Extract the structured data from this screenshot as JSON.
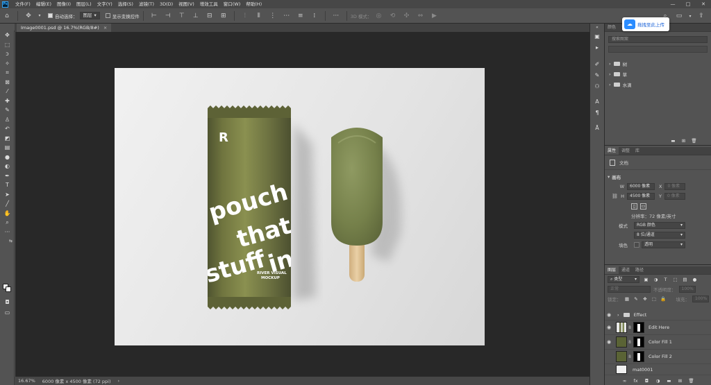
{
  "app": {
    "logo": "Ps"
  },
  "menu": [
    "文件(F)",
    "编辑(E)",
    "图像(I)",
    "图层(L)",
    "文字(Y)",
    "选择(S)",
    "滤镜(T)",
    "3D(D)",
    "视图(V)",
    "增效工具",
    "窗口(W)",
    "帮助(H)"
  ],
  "window_controls": {
    "minimize": "—",
    "maximize": "□",
    "close": "✕"
  },
  "options": {
    "auto_select_label": "自动选择：",
    "auto_select_target": "图层",
    "show_transform_label": "显示变换控件",
    "mode_3d_label": "3D 模式：",
    "more": "···"
  },
  "upload_button": {
    "label": "拖拽至此上传"
  },
  "document_tab": {
    "title": "Image0001.psd @ 16.7%(RGB/8#)",
    "close": "×"
  },
  "statusbar": {
    "zoom": "16.67%",
    "dimensions": "6000 像素 x 4500 像素 (72 ppi)",
    "arrow": "›"
  },
  "mockup": {
    "pouch_logo": "R",
    "pouch_headline_lines": [
      "pouch",
      "that",
      "stuff",
      "in"
    ],
    "pouch_caption_lines": [
      "RIVER VISUAL",
      "MOCKUP"
    ],
    "colors": {
      "pouch": "#6a6f43",
      "icecream": "#7c8654",
      "stick": "#e2c499",
      "artboard": "#ebebeb"
    }
  },
  "libraries_panel": {
    "tabs": [
      "颜色",
      "色板",
      "渐变",
      "图案"
    ],
    "search_placeholder": "搜索图案",
    "items": [
      {
        "label": "树"
      },
      {
        "label": "草"
      },
      {
        "label": "水滴"
      }
    ]
  },
  "properties_panel": {
    "tabs": [
      "属性",
      "调整",
      "库"
    ],
    "doc_label": "文档",
    "canvas_title": "画布",
    "width_label": "W",
    "width_value": "6000 像素",
    "x_label": "X",
    "x_placeholder": "0 像素",
    "height_label": "H",
    "height_value": "4500 像素",
    "y_label": "Y",
    "y_placeholder": "0 像素",
    "resolution": "分辨率：72 像素/英寸",
    "mode_label": "模式",
    "mode_value": "RGB 颜色",
    "bit_value": "8 位/通道",
    "fill_label": "填色",
    "fill_value": "透明"
  },
  "layers_panel": {
    "tabs": [
      "图层",
      "通道",
      "路径"
    ],
    "filter_kind": "类型",
    "blend_mode": "正常",
    "opacity_label": "不透明度：",
    "opacity_value": "100%",
    "lock_label": "锁定：",
    "fill_label": "填充：",
    "fill_value": "100%",
    "layers": [
      {
        "name": "Effect",
        "type": "group"
      },
      {
        "name": "Edit Here",
        "type": "smart"
      },
      {
        "name": "Color Fill 1",
        "type": "fill",
        "color": "#5a6335"
      },
      {
        "name": "Color Fill 2",
        "type": "fill",
        "color": "#5a6335"
      },
      {
        "name": "mat0001",
        "type": "image"
      }
    ],
    "footer_icons": [
      "link-icon",
      "fx-icon",
      "mask-icon",
      "adjustment-icon",
      "folder-icon",
      "new-layer-icon",
      "trash-icon"
    ]
  }
}
